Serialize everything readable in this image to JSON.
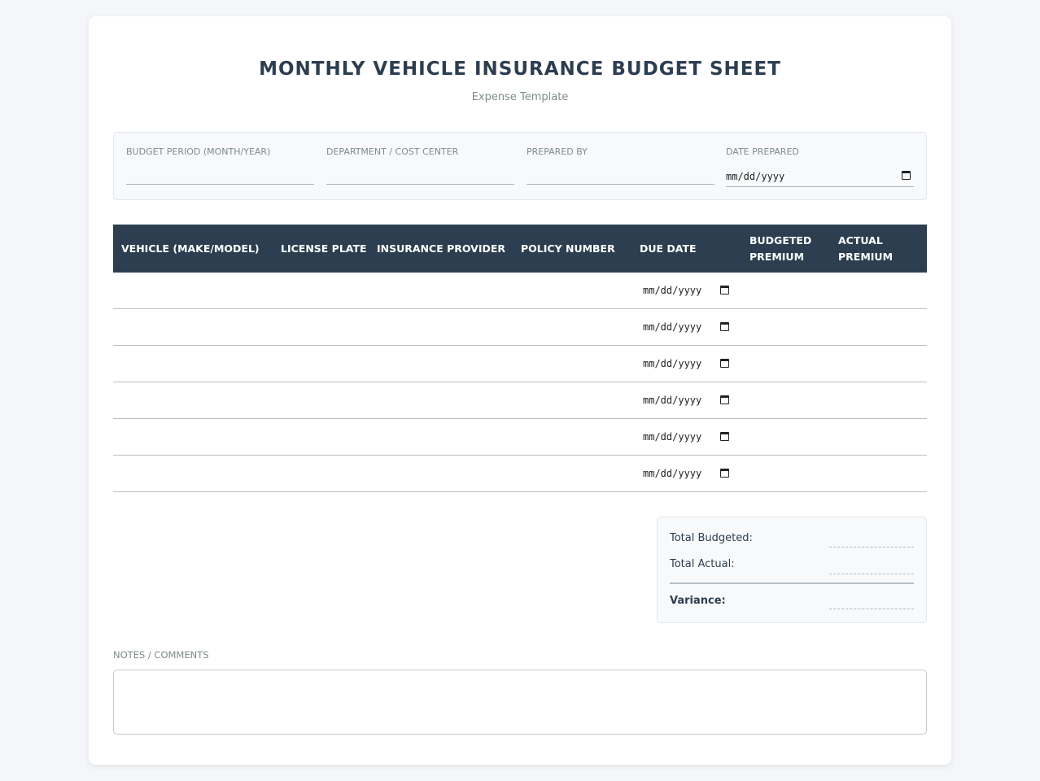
{
  "header": {
    "title": "MONTHLY VEHICLE INSURANCE BUDGET SHEET",
    "subtitle": "Expense Template"
  },
  "meta": {
    "budget_period_label": "BUDGET PERIOD (MONTH/YEAR)",
    "department_label": "DEPARTMENT / COST CENTER",
    "prepared_by_label": "PREPARED BY",
    "date_prepared_label": "DATE PREPARED",
    "date_placeholder": "mm/dd/yyyy"
  },
  "table": {
    "columns": [
      "VEHICLE (MAKE/MODEL)",
      "LICENSE PLATE",
      "INSURANCE PROVIDER",
      "POLICY NUMBER",
      "DUE DATE",
      "BUDGETED PREMIUM",
      "ACTUAL PREMIUM"
    ],
    "rows": [
      {
        "due_date": "mm/dd/yyyy"
      },
      {
        "due_date": "mm/dd/yyyy"
      },
      {
        "due_date": "mm/dd/yyyy"
      },
      {
        "due_date": "mm/dd/yyyy"
      },
      {
        "due_date": "mm/dd/yyyy"
      },
      {
        "due_date": "mm/dd/yyyy"
      }
    ]
  },
  "totals": {
    "total_budgeted_label": "Total Budgeted:",
    "total_actual_label": "Total Actual:",
    "variance_label": "Variance:"
  },
  "notes": {
    "label": "NOTES / COMMENTS"
  },
  "colors": {
    "header_bg": "#2c3e50",
    "page_bg": "#f4f6f9",
    "muted_text": "#7f8c8d"
  }
}
